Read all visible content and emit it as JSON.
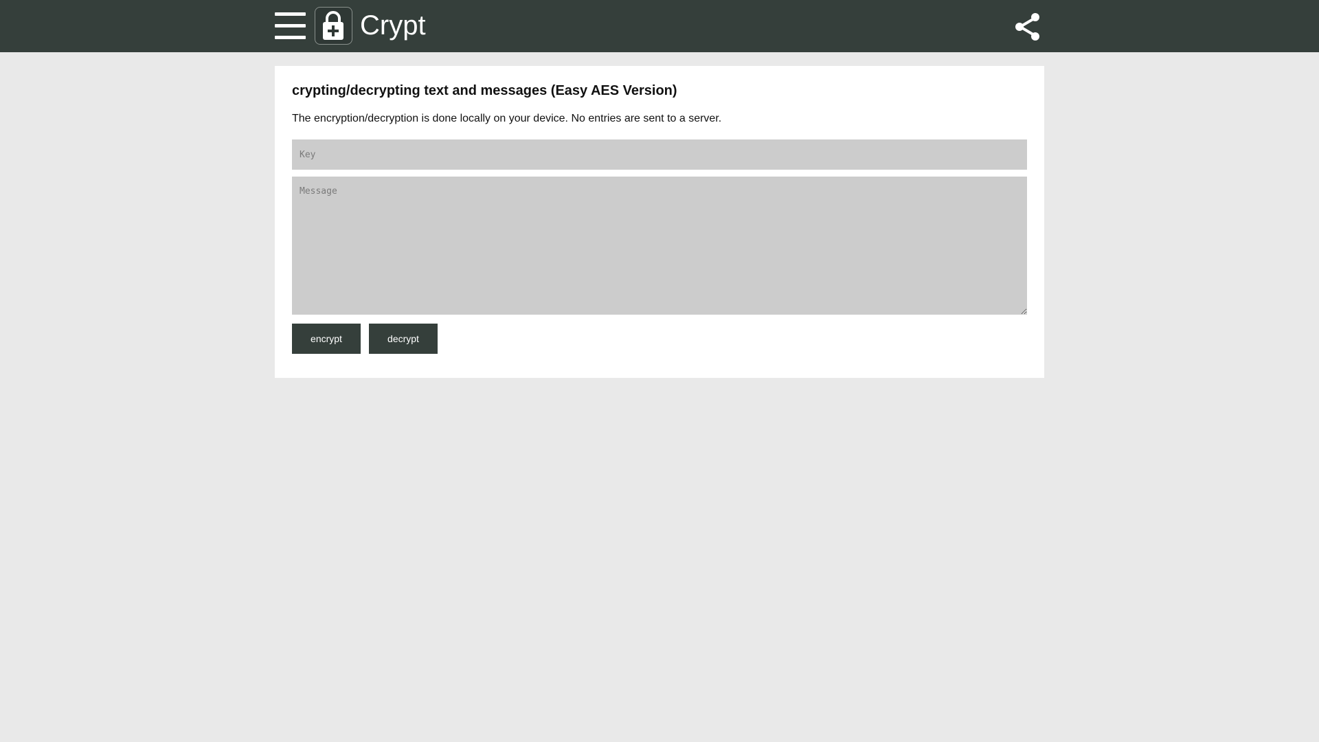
{
  "header": {
    "app_title": "Crypt",
    "menu_icon": "hamburger-menu-icon",
    "logo_icon": "lock-plus-icon",
    "share_icon": "share-icon",
    "bar_color": "#353f3b"
  },
  "main": {
    "heading": "crypting/decrypting text and messages (Easy AES Version)",
    "description": "The encryption/decryption is done locally on your device. No entries are sent to a server.",
    "key_field": {
      "placeholder": "Key",
      "value": ""
    },
    "message_field": {
      "placeholder": "Message",
      "value": ""
    },
    "buttons": {
      "encrypt_label": "encrypt",
      "decrypt_label": "decrypt"
    }
  },
  "colors": {
    "background": "#e9e9e9",
    "card": "#ffffff",
    "input_fill": "#cccccc",
    "accent": "#353f3b"
  }
}
